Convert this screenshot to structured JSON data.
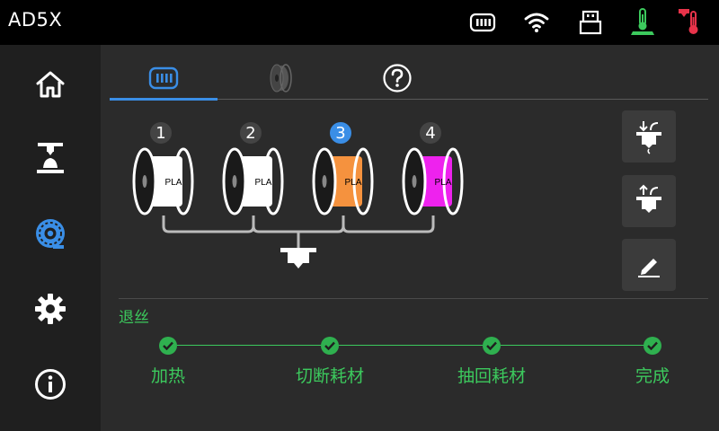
{
  "topbar": {
    "title": "AD5X",
    "icons": [
      "filament-unit-icon",
      "wifi-icon",
      "usb-icon",
      "bed-temperature-icon",
      "nozzle-temperature-icon"
    ]
  },
  "sidebar": {
    "items": [
      {
        "name": "home",
        "icon": "home-icon"
      },
      {
        "name": "print",
        "icon": "print-icon"
      },
      {
        "name": "filament",
        "icon": "filament-icon",
        "active": true
      },
      {
        "name": "settings",
        "icon": "gear-icon"
      },
      {
        "name": "info",
        "icon": "info-icon"
      }
    ]
  },
  "tabs": [
    {
      "icon": "filament-unit-icon",
      "active": true
    },
    {
      "icon": "spool-icon"
    },
    {
      "icon": "help-icon"
    }
  ],
  "slots": [
    {
      "number": "1",
      "material": "PLA",
      "color": "#ffffff"
    },
    {
      "number": "2",
      "material": "PLA",
      "color": "#ffffff"
    },
    {
      "number": "3",
      "material": "PLA",
      "color": "#f5923e",
      "active": true
    },
    {
      "number": "4",
      "material": "PLA",
      "color": "#ee22ee"
    }
  ],
  "actions": [
    {
      "icon": "load-filament-icon"
    },
    {
      "icon": "unload-filament-icon"
    },
    {
      "icon": "edit-icon"
    }
  ],
  "process": {
    "title": "退丝",
    "steps": [
      "加热",
      "切断耗材",
      "抽回耗材",
      "完成"
    ]
  },
  "colors": {
    "accent": "#3a8ee6",
    "success": "#3cc95d"
  }
}
